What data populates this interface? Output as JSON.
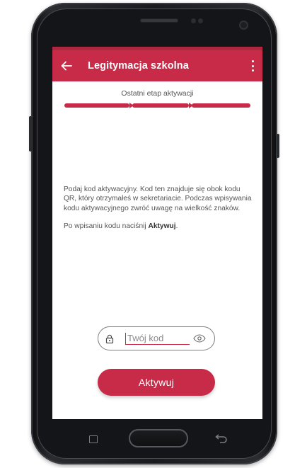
{
  "appbar": {
    "title": "Legitymacja szkolna"
  },
  "step": {
    "label": "Ostatni etap aktywacji"
  },
  "instructions": {
    "paragraph1": "Podaj kod aktywacyjny. Kod ten znajduje się obok kodu QR, który otrzymałeś w sekretariacie. Podczas wpisywania kodu aktywacyjnego zwróć uwagę na wielkość znaków.",
    "paragraph2_prefix": "Po wpisaniu kodu naciśnij ",
    "paragraph2_bold": "Aktywuj",
    "paragraph2_suffix": "."
  },
  "code_field": {
    "placeholder": "Twój kod",
    "value": ""
  },
  "activate_button": {
    "label": "Aktywuj"
  },
  "icons": {
    "back": "arrow-left-icon",
    "menu": "more-vertical-icon",
    "lock": "lock-icon",
    "eye": "eye-icon",
    "recent": "recent-apps-icon",
    "nav_back": "nav-back-icon"
  },
  "colors": {
    "accent": "#c72b47",
    "statusbar": "#b0283f",
    "text": "#555555"
  }
}
